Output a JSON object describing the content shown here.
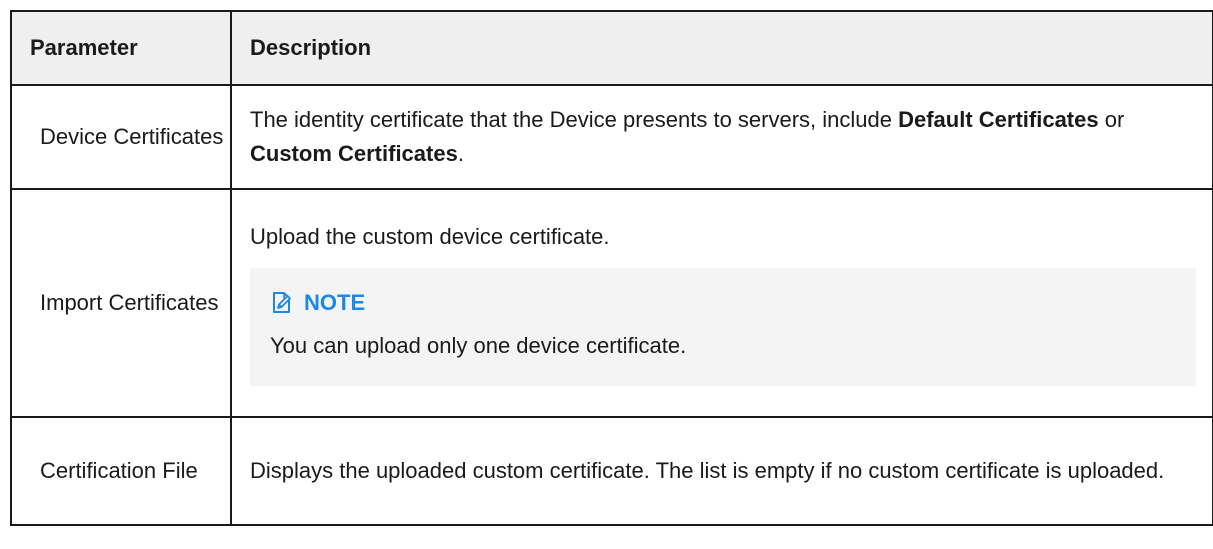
{
  "table": {
    "headers": {
      "parameter": "Parameter",
      "description": "Description"
    },
    "rows": [
      {
        "parameter": "Device Certificates",
        "description": {
          "before": "The identity certificate that the Device presents to servers, include ",
          "bold1": "Default Certificates",
          "middle": " or ",
          "bold2": "Custom Certificates",
          "after": "."
        }
      },
      {
        "parameter": "Import Certificates",
        "description": {
          "intro": "Upload the custom device certificate.",
          "note": {
            "icon": "note-edit-icon",
            "title": "NOTE",
            "text": "You can upload only one device certificate."
          }
        }
      },
      {
        "parameter": "Certification File",
        "description": {
          "text": "Displays the uploaded custom certificate. The list is empty if no custom certificate is uploaded."
        }
      }
    ]
  },
  "colors": {
    "header_bg": "#efefef",
    "note_bg": "#f4f4f4",
    "note_accent": "#1e88e5",
    "border": "#1a1a1a"
  }
}
